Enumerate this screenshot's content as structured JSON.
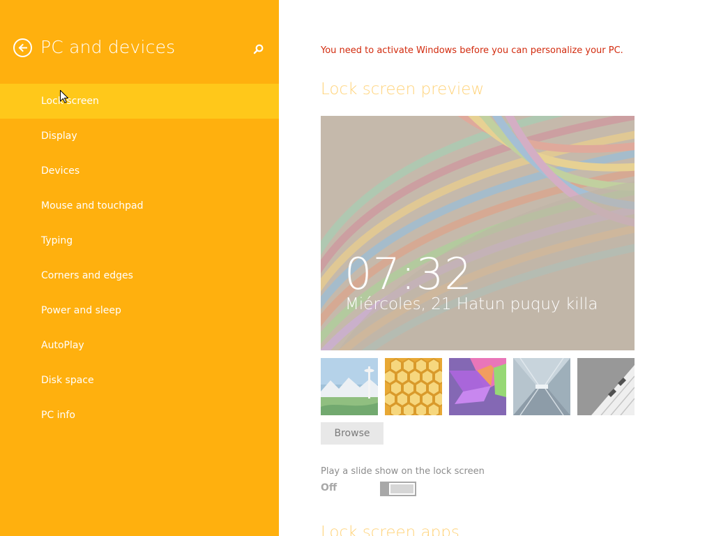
{
  "colors": {
    "left_pane_bg": "#ffb00e",
    "active_nav_bg": "#ffc81a",
    "activation_text": "#d22b0e",
    "section_title": "#ffd37a",
    "toggle_gray": "#a8a8a8"
  },
  "header": {
    "back_icon": "back-arrow-circle-icon",
    "title": "PC and devices",
    "search_icon": "search-icon"
  },
  "nav": {
    "items": [
      {
        "label": "Lock screen",
        "active": true
      },
      {
        "label": "Display",
        "active": false
      },
      {
        "label": "Devices",
        "active": false
      },
      {
        "label": "Mouse and touchpad",
        "active": false
      },
      {
        "label": "Typing",
        "active": false
      },
      {
        "label": "Corners and edges",
        "active": false
      },
      {
        "label": "Power and sleep",
        "active": false
      },
      {
        "label": "AutoPlay",
        "active": false
      },
      {
        "label": "Disk space",
        "active": false
      },
      {
        "label": "PC info",
        "active": false
      }
    ]
  },
  "main": {
    "activation_notice": "You need to activate Windows before you can personalize your PC.",
    "preview": {
      "title": "Lock screen preview",
      "time": "07:32",
      "date": "Miércoles, 21 Hatun puquy killa"
    },
    "thumbnails": [
      {
        "name": "space-needle-thumbnail"
      },
      {
        "name": "honeycomb-thumbnail"
      },
      {
        "name": "color-shapes-thumbnail"
      },
      {
        "name": "tunnel-thumbnail"
      },
      {
        "name": "piano-keys-thumbnail"
      }
    ],
    "browse_label": "Browse",
    "slideshow": {
      "label": "Play a slide show on the lock screen",
      "state": "Off"
    },
    "apps_title": "Lock screen apps"
  }
}
